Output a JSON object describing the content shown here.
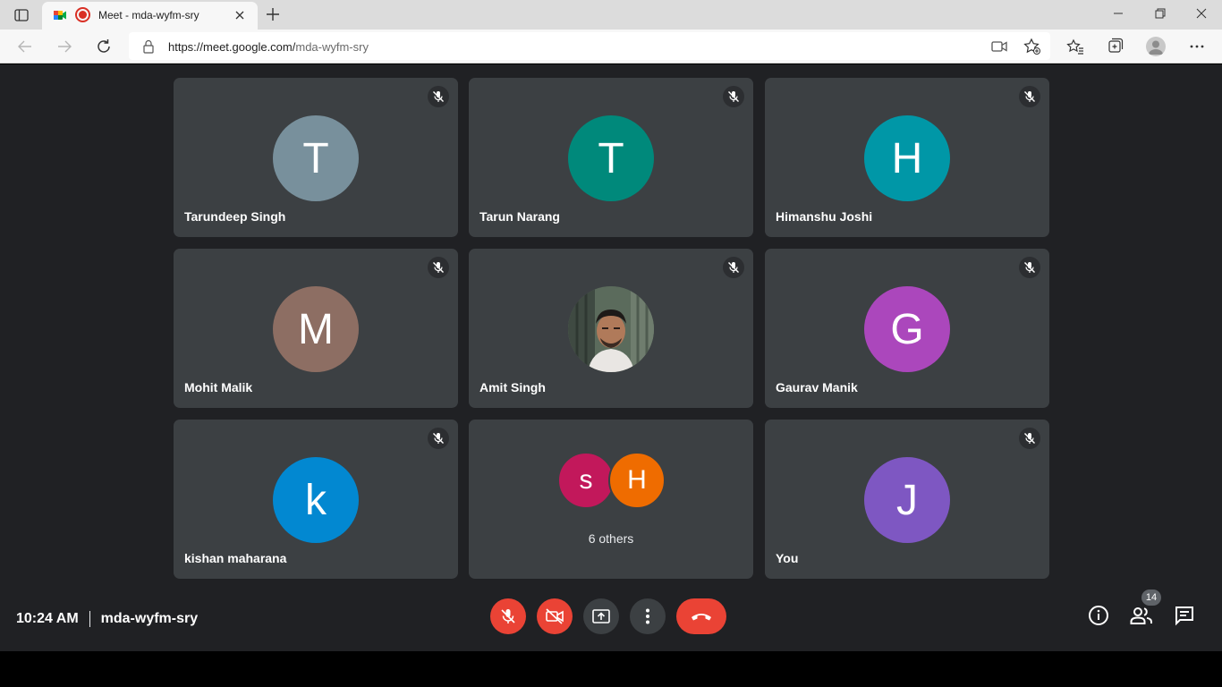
{
  "browser": {
    "tab_title": "Meet - mda-wyfm-sry",
    "url_host": "https://meet.google.com/",
    "url_path": "mda-wyfm-sry"
  },
  "participants": [
    {
      "name": "Tarundeep Singh",
      "initial": "T",
      "color": "#78909c",
      "muted": true
    },
    {
      "name": "Tarun Narang",
      "initial": "T",
      "color": "#00897b",
      "muted": true
    },
    {
      "name": "Himanshu Joshi",
      "initial": "H",
      "color": "#0097a7",
      "muted": true
    },
    {
      "name": "Mohit Malik",
      "initial": "M",
      "color": "#8d6e63",
      "muted": true
    },
    {
      "name": "Amit Singh",
      "initial": "",
      "color": "#556b5d",
      "muted": true,
      "photo": true
    },
    {
      "name": "Gaurav Manik",
      "initial": "G",
      "color": "#ab47bc",
      "muted": true
    },
    {
      "name": "kishan maharana",
      "initial": "k",
      "color": "#0288d1",
      "muted": true
    },
    {
      "name": "You",
      "initial": "J",
      "color": "#7e57c2",
      "muted": true
    }
  ],
  "others_tile": {
    "label": "6 others",
    "avatars": [
      {
        "initial": "s",
        "color": "#c2185b"
      },
      {
        "initial": "H",
        "color": "#ef6c00"
      }
    ]
  },
  "bottom_bar": {
    "time": "10:24 AM",
    "meeting_code": "mda-wyfm-sry",
    "participant_count": "14"
  },
  "colors": {
    "meet_bg": "#202124",
    "tile_bg": "#3c4043",
    "danger": "#ea4335"
  }
}
